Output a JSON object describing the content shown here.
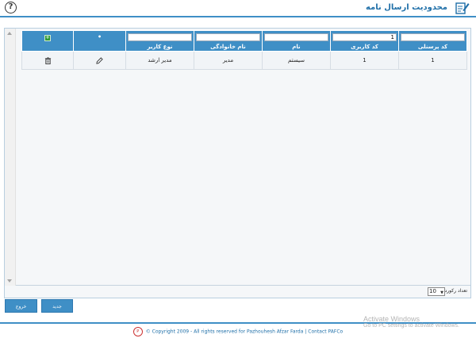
{
  "header": {
    "title": "محدودیت ارسال نامه",
    "help_icon": "?"
  },
  "grid": {
    "columns": [
      {
        "key": "personnel_code",
        "label": "کد پرسنلی",
        "filter": ""
      },
      {
        "key": "user_code",
        "label": "کد کاربری",
        "filter": "1"
      },
      {
        "key": "first_name",
        "label": "نام",
        "filter": ""
      },
      {
        "key": "last_name",
        "label": "نام خانوادگی",
        "filter": ""
      },
      {
        "key": "user_type",
        "label": "نوع کاربر",
        "filter": ""
      }
    ],
    "edit_col_mark": "•",
    "action_col_badge": "+",
    "rows": [
      {
        "personnel_code": "1",
        "user_code": "1",
        "first_name": "سیستم",
        "last_name": "مدیر",
        "user_type": "مدیر ارشد"
      }
    ]
  },
  "pager": {
    "page_size": "10",
    "label": "تعداد رکورد"
  },
  "buttons": {
    "new": "جدید",
    "exit": "خروج"
  },
  "footer": {
    "logo": "P",
    "text": "© Copyright 2009 - All rights reserved for Pazhouhesh Afzar Farda",
    "contact": "Contact PAFCo"
  },
  "watermark": {
    "title": "Activate Windows",
    "subtitle": "Go to PC settings to activate Windows."
  },
  "colors": {
    "accent": "#3f8fc6",
    "title": "#1f6fa8",
    "badge": "#2e9a37"
  }
}
